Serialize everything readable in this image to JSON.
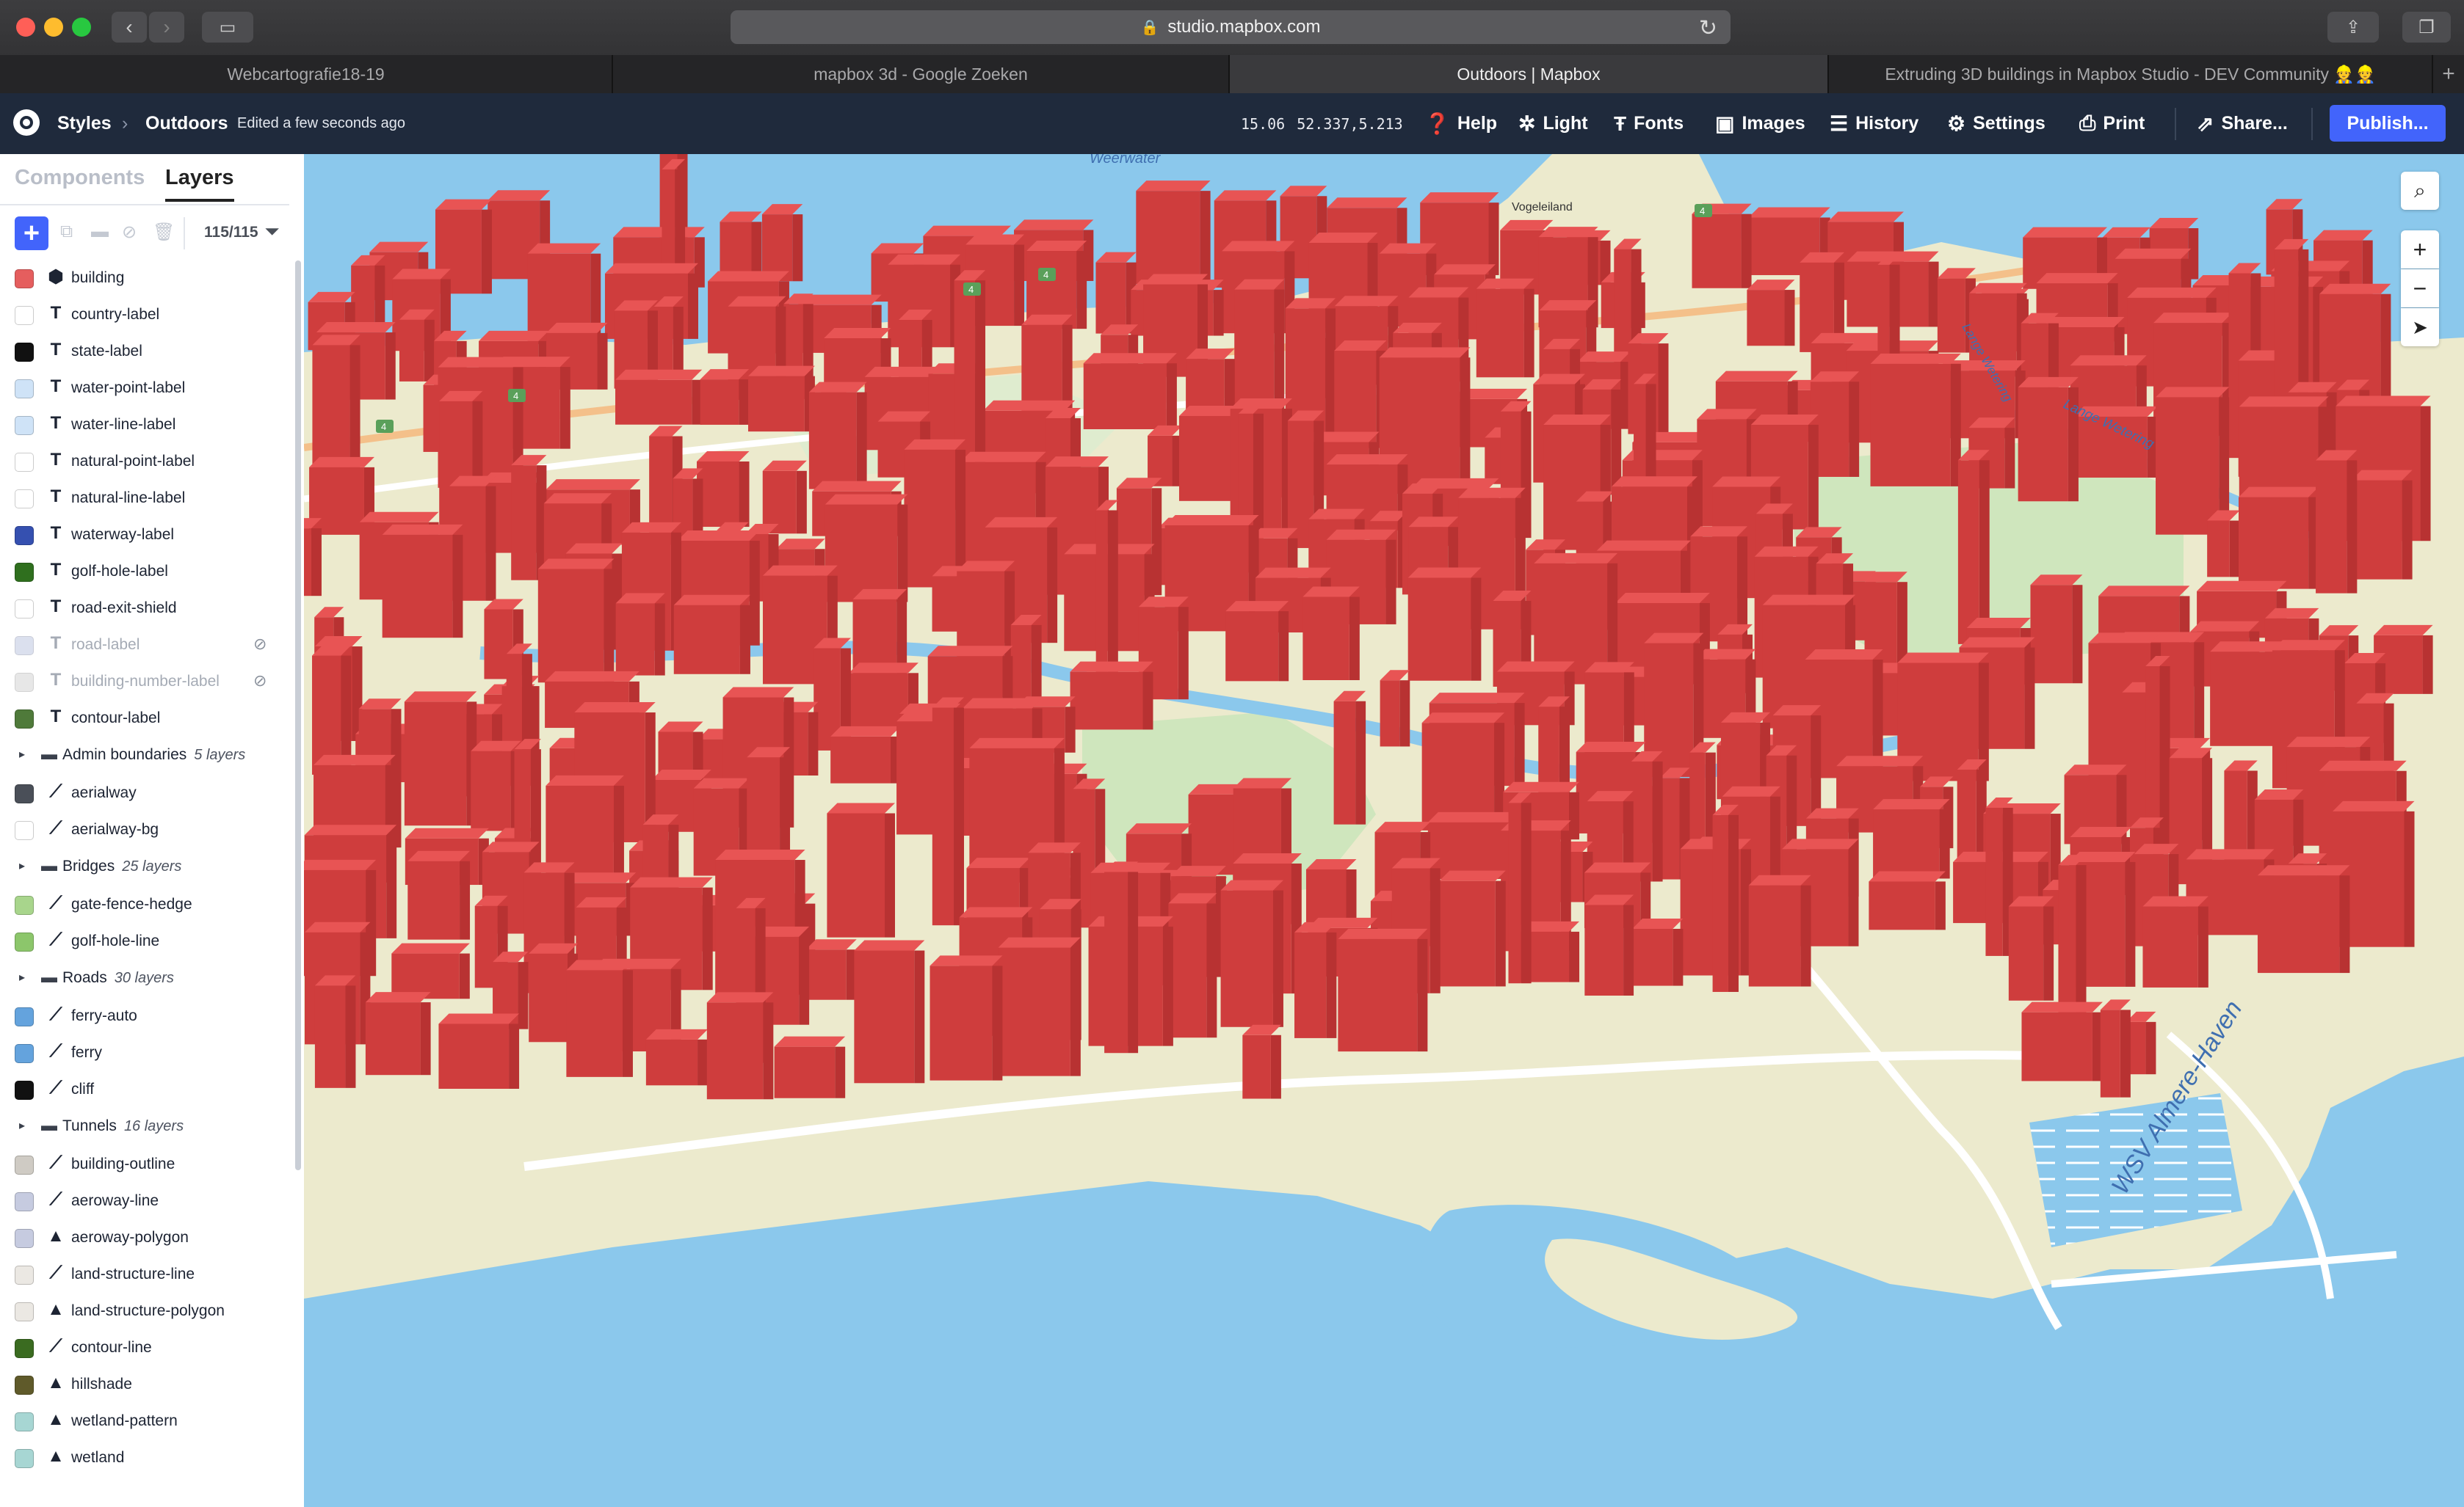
{
  "browser": {
    "url": "studio.mapbox.com",
    "tabs": [
      {
        "label": "Webcartografie18-19"
      },
      {
        "label": "mapbox 3d - Google Zoeken"
      },
      {
        "label": "Outdoors | Mapbox"
      },
      {
        "label": "Extruding 3D buildings in Mapbox Studio - DEV Community 👷👷"
      }
    ],
    "new_tab": "+"
  },
  "header": {
    "styles": "Styles",
    "breadcrumb_sep": "›",
    "style_name": "Outdoors",
    "edit_status": "Edited a few seconds ago",
    "zoom": "15.06",
    "lnglat": "52.337,5.213",
    "menu": [
      {
        "label": "Help",
        "icon": "help-icon"
      },
      {
        "label": "Light",
        "icon": "light-icon"
      },
      {
        "label": "Fonts",
        "icon": "fonts-icon"
      },
      {
        "label": "Images",
        "icon": "images-icon"
      },
      {
        "label": "History",
        "icon": "history-icon"
      },
      {
        "label": "Settings",
        "icon": "settings-icon"
      },
      {
        "label": "Print",
        "icon": "print-icon"
      },
      {
        "label": "Share...",
        "icon": "share-icon"
      }
    ],
    "publish": "Publish..."
  },
  "sidebar": {
    "components_tab": "Components",
    "layers_tab": "Layers",
    "layer_count": "115/115",
    "layers": [
      {
        "kind": "layer",
        "name": "building",
        "type": "3d",
        "color": "#e55e5e"
      },
      {
        "kind": "layer",
        "name": "country-label",
        "type": "text",
        "color": "#ffffff"
      },
      {
        "kind": "layer",
        "name": "state-label",
        "type": "text",
        "color": "#111111"
      },
      {
        "kind": "layer",
        "name": "water-point-label",
        "type": "text",
        "color": "#cfe3f7"
      },
      {
        "kind": "layer",
        "name": "water-line-label",
        "type": "text",
        "color": "#cfe3f7"
      },
      {
        "kind": "layer",
        "name": "natural-point-label",
        "type": "text",
        "color": "#ffffff"
      },
      {
        "kind": "layer",
        "name": "natural-line-label",
        "type": "text",
        "color": "#ffffff"
      },
      {
        "kind": "layer",
        "name": "waterway-label",
        "type": "text",
        "color": "#3550b0"
      },
      {
        "kind": "layer",
        "name": "golf-hole-label",
        "type": "text",
        "color": "#2f6f1e"
      },
      {
        "kind": "layer",
        "name": "road-exit-shield",
        "type": "text",
        "color": "#ffffff"
      },
      {
        "kind": "layer",
        "name": "road-label",
        "type": "text",
        "color": "#b9c2de",
        "hidden": true
      },
      {
        "kind": "layer",
        "name": "building-number-label",
        "type": "text",
        "color": "#d0d0d0",
        "hidden": true
      },
      {
        "kind": "layer",
        "name": "contour-label",
        "type": "text",
        "color": "#4f7a3a"
      },
      {
        "kind": "group",
        "name": "Admin boundaries",
        "count": "5 layers"
      },
      {
        "kind": "layer",
        "name": "aerialway",
        "type": "line",
        "color": "#4a4f58"
      },
      {
        "kind": "layer",
        "name": "aerialway-bg",
        "type": "line",
        "color": "#ffffff"
      },
      {
        "kind": "group",
        "name": "Bridges",
        "count": "25 layers"
      },
      {
        "kind": "layer",
        "name": "gate-fence-hedge",
        "type": "line",
        "color": "#a8d58c"
      },
      {
        "kind": "layer",
        "name": "golf-hole-line",
        "type": "line",
        "color": "#8cc66b"
      },
      {
        "kind": "group",
        "name": "Roads",
        "count": "30 layers"
      },
      {
        "kind": "layer",
        "name": "ferry-auto",
        "type": "line",
        "color": "#64a3dd"
      },
      {
        "kind": "layer",
        "name": "ferry",
        "type": "line",
        "color": "#64a3dd"
      },
      {
        "kind": "layer",
        "name": "cliff",
        "type": "line",
        "color": "#111111"
      },
      {
        "kind": "group",
        "name": "Tunnels",
        "count": "16 layers"
      },
      {
        "kind": "layer",
        "name": "building-outline",
        "type": "line",
        "color": "#cfcbc4"
      },
      {
        "kind": "layer",
        "name": "aeroway-line",
        "type": "line",
        "color": "#c6cbe0"
      },
      {
        "kind": "layer",
        "name": "aeroway-polygon",
        "type": "fill",
        "color": "#c6cbe0"
      },
      {
        "kind": "layer",
        "name": "land-structure-line",
        "type": "line",
        "color": "#ebe8e3"
      },
      {
        "kind": "layer",
        "name": "land-structure-polygon",
        "type": "fill",
        "color": "#ebe8e3"
      },
      {
        "kind": "layer",
        "name": "contour-line",
        "type": "line",
        "color": "#3a6b20"
      },
      {
        "kind": "layer",
        "name": "hillshade",
        "type": "fill",
        "color": "#5f5a2a"
      },
      {
        "kind": "layer",
        "name": "wetland-pattern",
        "type": "fill",
        "color": "#a7d6d3"
      },
      {
        "kind": "layer",
        "name": "wetland",
        "type": "fill",
        "color": "#a7d6d3"
      }
    ]
  },
  "map": {
    "labels": {
      "weerwater": "Weerwater",
      "vogeleiland": "Vogeleiland",
      "lange_wetering": "Lange Wetering",
      "lange_wetering_short": "Lange Wetering",
      "wsv_haven": "WSV Almere-Haven",
      "shield_a": "4",
      "shield_b": "4",
      "shield_c": "4",
      "shield_d": "4",
      "shield_e": "4"
    },
    "colors": {
      "water": "#8bc8ec",
      "land": "#eceacd",
      "park": "#cfe6bd",
      "building": "#e04c4c",
      "road": "#ffffff"
    }
  }
}
